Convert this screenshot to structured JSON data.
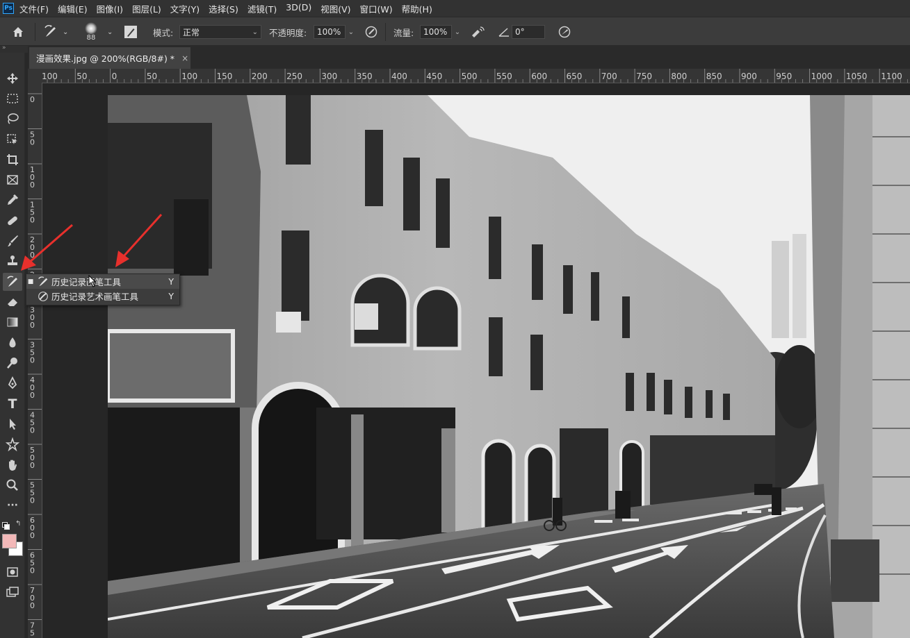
{
  "app": {
    "logo": "Ps"
  },
  "menu": [
    "文件(F)",
    "编辑(E)",
    "图像(I)",
    "图层(L)",
    "文字(Y)",
    "选择(S)",
    "滤镜(T)",
    "3D(D)",
    "视图(V)",
    "窗口(W)",
    "帮助(H)"
  ],
  "options": {
    "brush_size": "88",
    "mode_label": "模式:",
    "mode_value": "正常",
    "opacity_label": "不透明度:",
    "opacity_value": "100%",
    "flow_label": "流量:",
    "flow_value": "100%",
    "angle_value": "0°"
  },
  "collapse_glyph": "»",
  "document_tab": {
    "title": "漫画效果.jpg @ 200%(RGB/8#) *",
    "close": "×"
  },
  "ruler_top": [
    "100",
    "50",
    "0",
    "50",
    "100",
    "150",
    "200",
    "250",
    "300",
    "350",
    "400",
    "450",
    "500",
    "550",
    "600",
    "650",
    "700",
    "750",
    "800",
    "850",
    "900",
    "950",
    "1000",
    "1050",
    "1100"
  ],
  "ruler_left": [
    "0",
    "5 0",
    "1 0 0",
    "1 5 0",
    "2 0 0",
    "2 5 0",
    "3 0 0",
    "3 5 0",
    "4 0 0",
    "4 5 0",
    "5 0 0",
    "5 5 0",
    "6 0 0",
    "6 5 0",
    "7 0 0",
    "7 5"
  ],
  "flyout": {
    "items": [
      {
        "label": "历史记录画笔工具",
        "shortcut": "Y",
        "selected": true
      },
      {
        "label": "历史记录艺术画笔工具",
        "shortcut": "Y",
        "selected": false
      }
    ],
    "bullet": "■"
  },
  "toolbar": {
    "tools": [
      "move-icon",
      "marquee-icon",
      "lasso-icon",
      "object-select-icon",
      "crop-icon",
      "frame-icon",
      "eyedropper-icon",
      "healing-icon",
      "brush-icon",
      "stamp-icon",
      "history-brush-icon",
      "eraser-icon",
      "gradient-icon",
      "blur-icon",
      "dodge-icon",
      "pen-icon",
      "type-icon",
      "path-select-icon",
      "shape-icon",
      "hand-icon",
      "zoom-icon",
      "more-icon"
    ],
    "type_glyph": "T",
    "more_glyph": "···",
    "foreground_color": "#f2b8b8",
    "background_color": "#ffffff"
  },
  "colors": {
    "arrow": "#e8302c",
    "photo_sky": "#eeeeee"
  }
}
